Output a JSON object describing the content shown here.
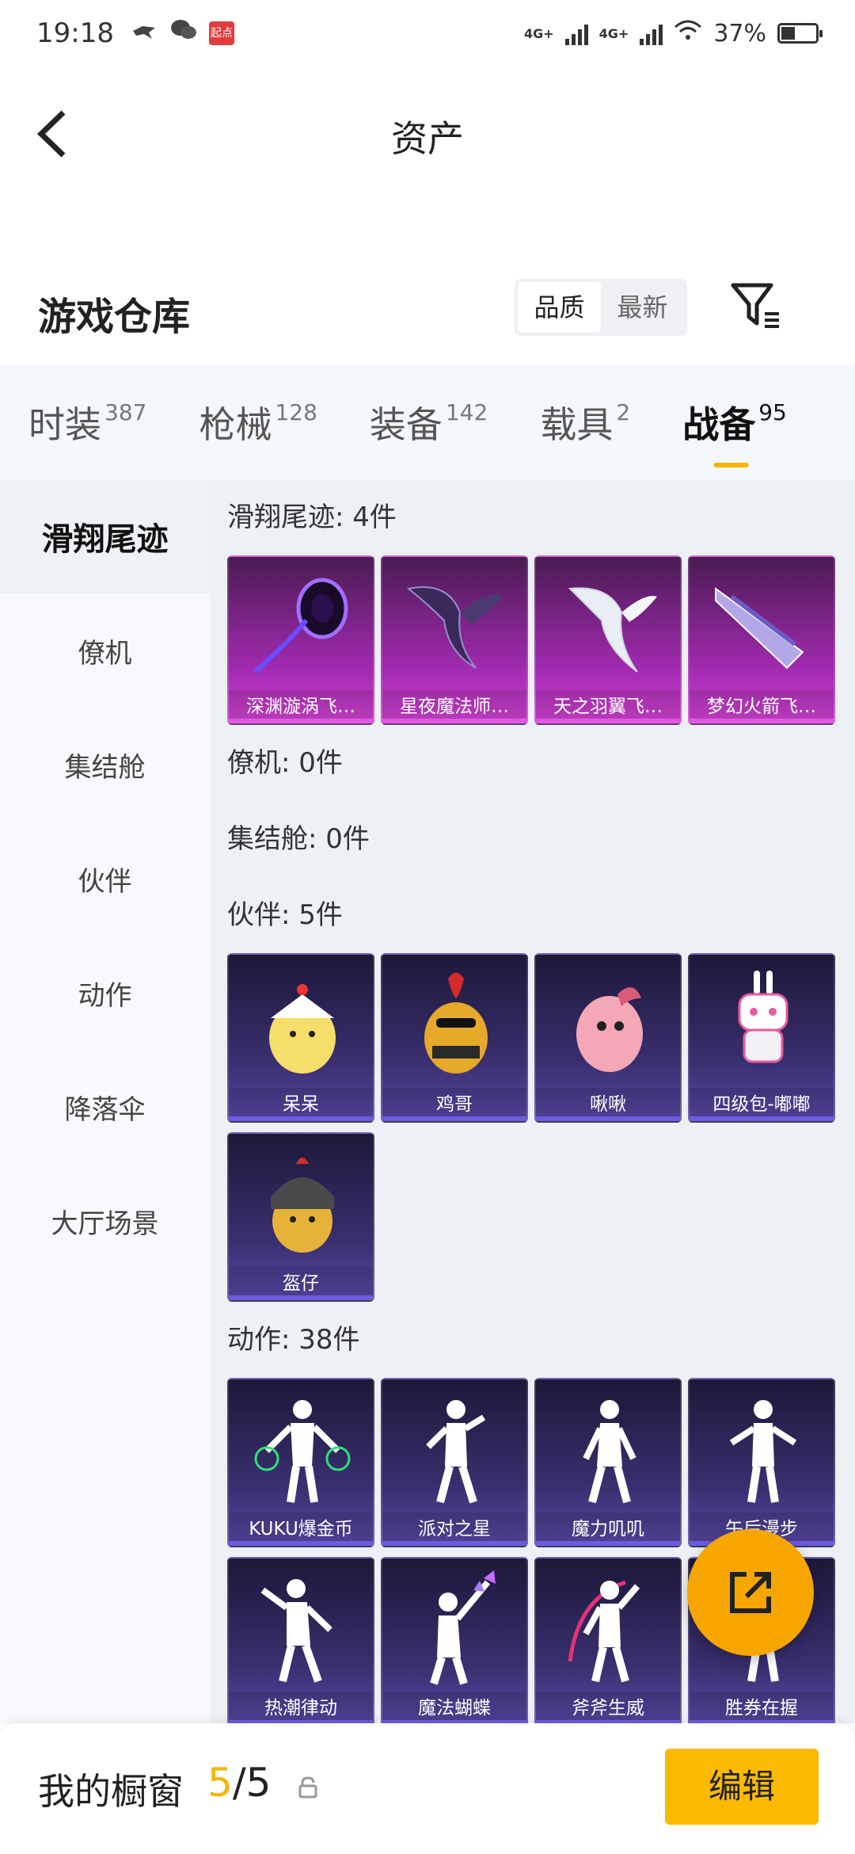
{
  "status_bar": {
    "time": "19:18",
    "badge": "起点",
    "network1": "4G+",
    "network2": "4G+",
    "battery": "37%",
    "battery_level": 0.37
  },
  "header": {
    "title": "资产"
  },
  "warehouse": {
    "title": "游戏仓库",
    "sort_options": [
      "品质",
      "最新"
    ],
    "active_sort": "品质"
  },
  "tabs": [
    {
      "label": "时装",
      "count": "387"
    },
    {
      "label": "枪械",
      "count": "128"
    },
    {
      "label": "装备",
      "count": "142"
    },
    {
      "label": "载具",
      "count": "2"
    },
    {
      "label": "战备",
      "count": "95"
    }
  ],
  "sidebar": {
    "items": [
      "滑翔尾迹",
      "僚机",
      "集结舱",
      "伙伴",
      "动作",
      "降落伞",
      "大厅场景"
    ]
  },
  "sections": {
    "glide": {
      "title": "滑翔尾迹: 4件",
      "items": [
        "深渊漩涡飞…",
        "星夜魔法师…",
        "天之羽翼飞…",
        "梦幻火箭飞…"
      ]
    },
    "wingman": {
      "title": "僚机: 0件"
    },
    "pod": {
      "title": "集结舱: 0件"
    },
    "partner": {
      "title": "伙伴: 5件",
      "items": [
        "呆呆",
        "鸡哥",
        "啾啾",
        "四级包-嘟嘟",
        "盔仔"
      ]
    },
    "action": {
      "title": "动作: 38件",
      "items": [
        "KUKU爆金币",
        "派对之星",
        "魔力叽叽",
        "午后漫步",
        "热潮律动",
        "魔法蝴蝶",
        "斧斧生威",
        "胜券在握"
      ]
    }
  },
  "bottom": {
    "title": "我的橱窗",
    "current": "5",
    "total": "/5",
    "edit_label": "编辑"
  },
  "colors": {
    "accent": "#f5b400",
    "fab": "#f7a600",
    "glide_card": "#a52bb4",
    "partner_card": "#3a2f70"
  }
}
